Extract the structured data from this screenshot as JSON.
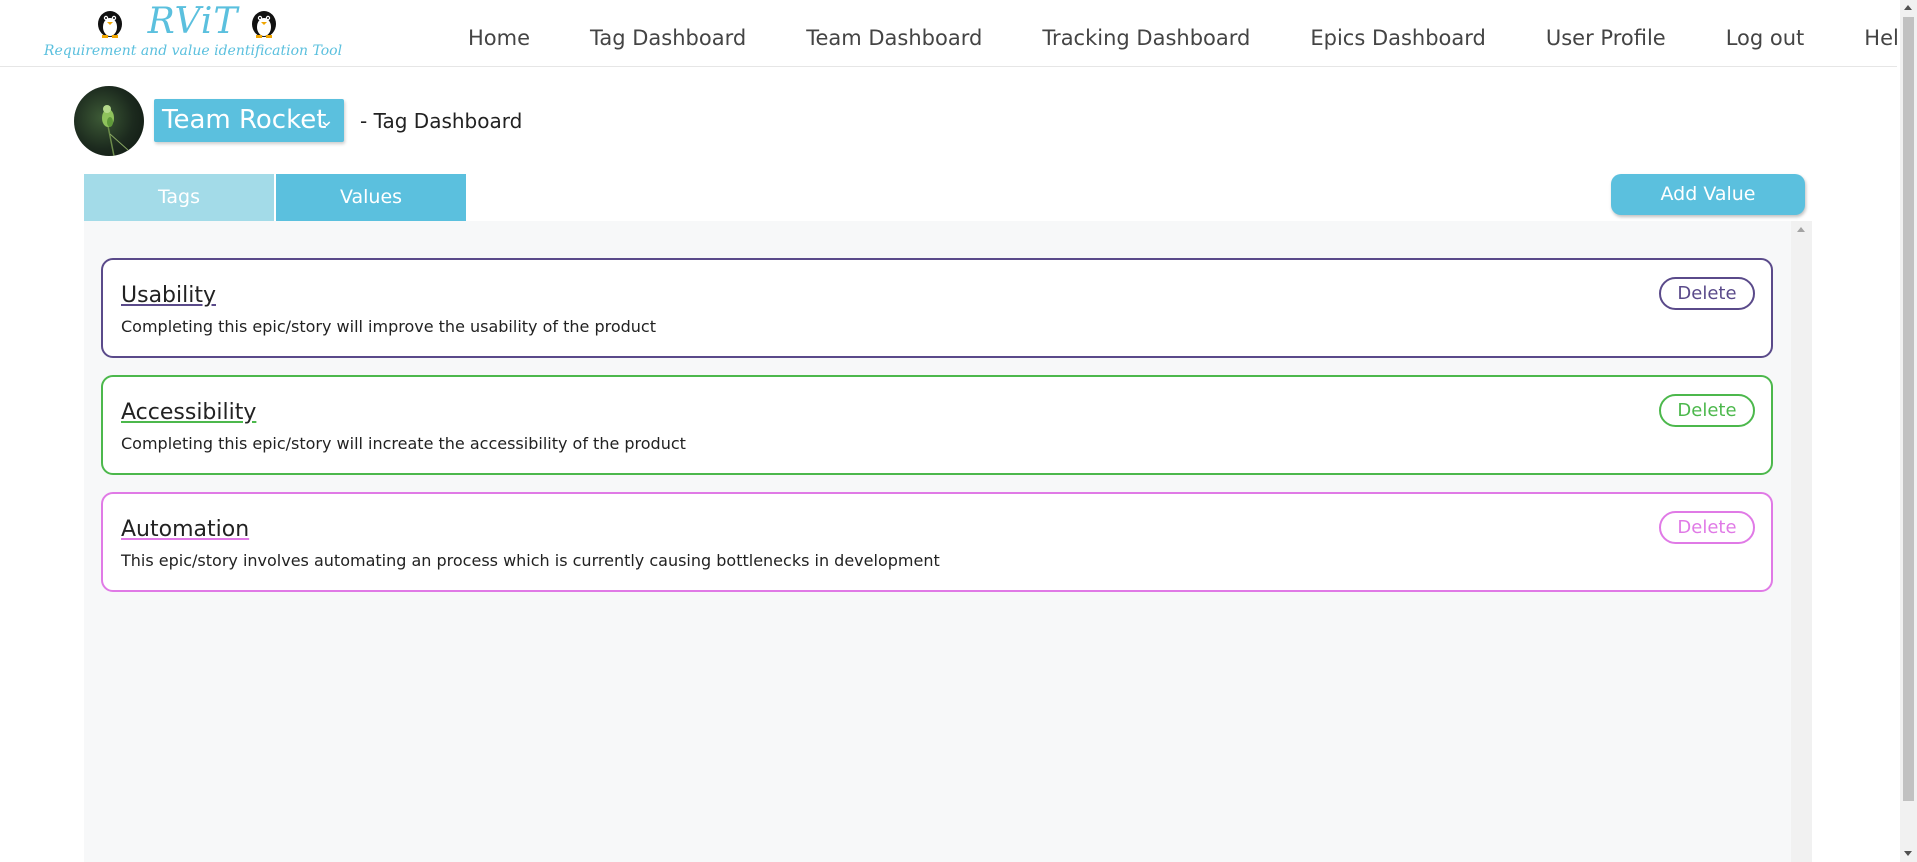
{
  "logo": {
    "title": "RViT",
    "subtitle": "Requirement and value identification Tool",
    "icon": "penguin-icon"
  },
  "nav": {
    "items": [
      {
        "label": "Home"
      },
      {
        "label": "Tag Dashboard"
      },
      {
        "label": "Team Dashboard"
      },
      {
        "label": "Tracking Dashboard"
      },
      {
        "label": "Epics Dashboard"
      },
      {
        "label": "User Profile"
      },
      {
        "label": "Log out"
      },
      {
        "label": "Help"
      }
    ]
  },
  "team": {
    "selected": "Team Rocket",
    "page_subtitle": "- Tag Dashboard"
  },
  "tabs": [
    {
      "label": "Tags",
      "active": false
    },
    {
      "label": "Values",
      "active": true
    }
  ],
  "actions": {
    "add_value": "Add Value"
  },
  "values": [
    {
      "title": "Usability",
      "description": "Completing this epic/story will improve the usability of the product",
      "delete_label": "Delete",
      "color": "#5a4a8a"
    },
    {
      "title": "Accessibility",
      "description": "Completing this epic/story will increate the accessibility of the product",
      "delete_label": "Delete",
      "color": "#4cb84c"
    },
    {
      "title": "Automation",
      "description": "This epic/story involves automating an process which is currently causing bottlenecks in development",
      "delete_label": "Delete",
      "color": "#e07ae6"
    }
  ],
  "colors": {
    "accent": "#5bc0de",
    "tab_inactive": "#a3dbe8",
    "panel_bg": "#f7f8f9"
  }
}
